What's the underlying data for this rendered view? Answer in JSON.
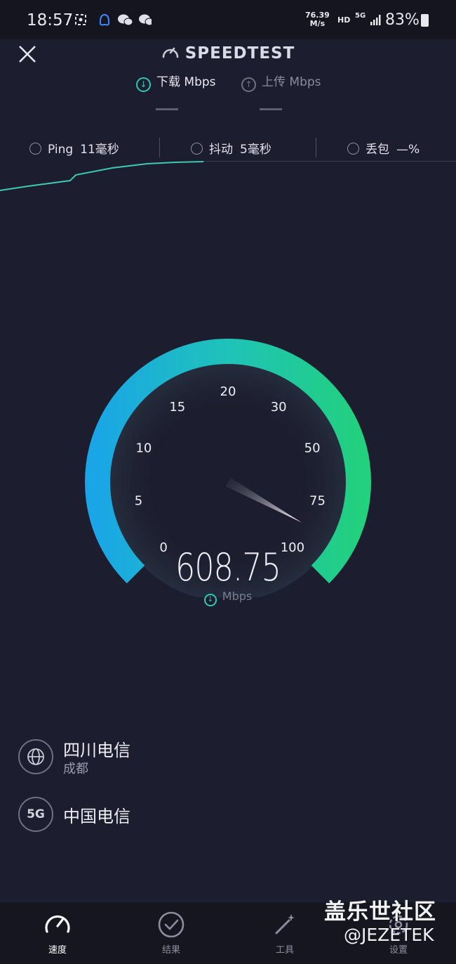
{
  "status_bar": {
    "time": "18:57",
    "net_speed_value": "76.39",
    "net_speed_unit": "M/s",
    "hd": "HD",
    "network": "5G",
    "battery": "83%"
  },
  "header": {
    "title": "SPEEDTEST",
    "download_label": "下载 Mbps",
    "upload_label": "上传 Mbps",
    "download_value": "—",
    "upload_value": "—"
  },
  "metrics": {
    "ping_label": "Ping",
    "ping_value": "11毫秒",
    "jitter_label": "抖动",
    "jitter_value": "5毫秒",
    "loss_label": "丢包",
    "loss_value": "—%"
  },
  "gauge": {
    "ticks": [
      "0",
      "5",
      "10",
      "15",
      "20",
      "30",
      "50",
      "75",
      "100"
    ],
    "needle_fraction": 0.94,
    "speed": "608.75",
    "unit": "Mbps",
    "colors": {
      "start": "#1aa6e6",
      "end": "#22d07e"
    }
  },
  "isp": {
    "provider": "四川电信",
    "city": "成都",
    "carrier_badge": "5G",
    "carrier": "中国电信"
  },
  "nav": {
    "items": [
      {
        "label": "速度",
        "icon": "speed-gauge-icon",
        "active": true
      },
      {
        "label": "结果",
        "icon": "check-circle-icon",
        "active": false
      },
      {
        "label": "工具",
        "icon": "magic-wand-icon",
        "active": false
      },
      {
        "label": "设置",
        "icon": "settings-icon",
        "active": false
      }
    ]
  },
  "watermark": {
    "line1": "盖乐世社区",
    "line2": "@JEZETEK"
  }
}
